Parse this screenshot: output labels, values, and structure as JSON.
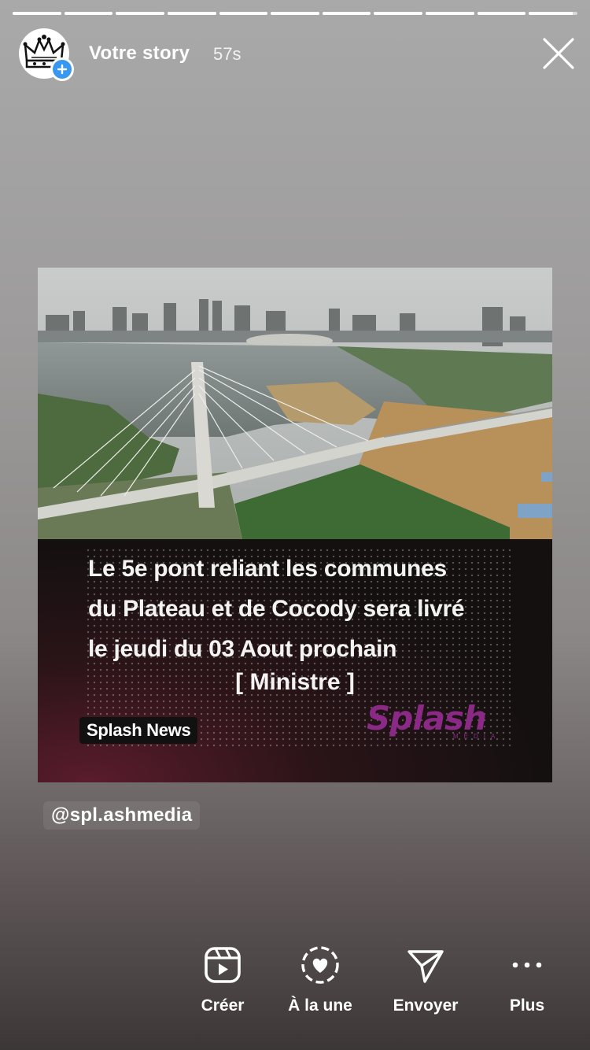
{
  "story": {
    "segments_total": 11,
    "segments_complete": 10,
    "current_segment_progress": 0.9
  },
  "header": {
    "username": "Votre story",
    "time": "57s",
    "avatar_icon": "crown-avatar",
    "close_icon": "close-icon"
  },
  "post": {
    "headline_lines": [
      "Le 5e pont reliant les communes",
      "du Plateau et de Cocody sera  livré",
      "le jeudi du 03 Aout prochain"
    ],
    "attribution": "[ Ministre ]",
    "brand_tag": "Splash News",
    "logo_text": "Splash",
    "logo_subtext": "MEDIA"
  },
  "mention": "@spl.ashmedia",
  "toolbar": {
    "items": [
      {
        "label": "Créer",
        "icon": "reels-icon"
      },
      {
        "label": "À la une",
        "icon": "highlight-heart-icon"
      },
      {
        "label": "Envoyer",
        "icon": "send-icon"
      },
      {
        "label": "Plus",
        "icon": "more-icon"
      }
    ]
  },
  "colors": {
    "badge_blue": "#3897f0",
    "logo_purple": "#8a2a86"
  }
}
